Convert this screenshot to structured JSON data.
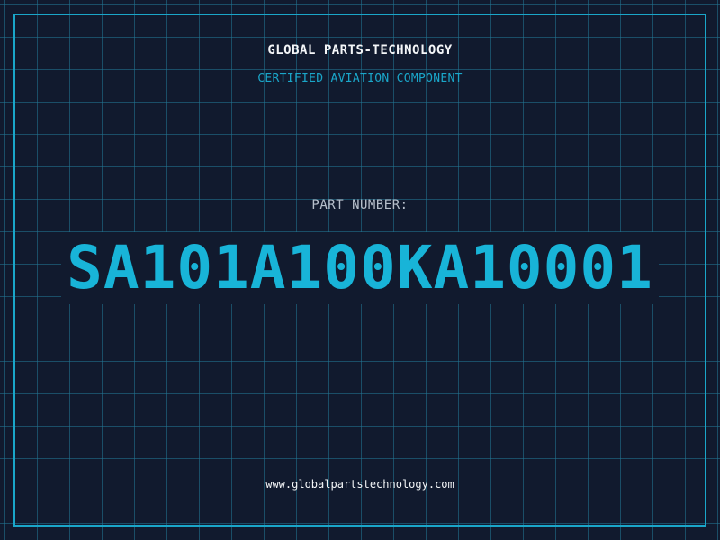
{
  "header": {
    "company": "GLOBAL PARTS-TECHNOLOGY",
    "subtitle": "CERTIFIED AVIATION COMPONENT"
  },
  "part": {
    "label": "PART NUMBER:",
    "number": "SA101A100KA10001"
  },
  "footer": {
    "website": "www.globalpartstechnology.com"
  },
  "colors": {
    "background": "#111a2e",
    "grid": "#22788f",
    "accent": "#1aa6c9",
    "part_number": "#18b4d8",
    "text": "#f4f6f8",
    "label": "#b8c0cc"
  }
}
